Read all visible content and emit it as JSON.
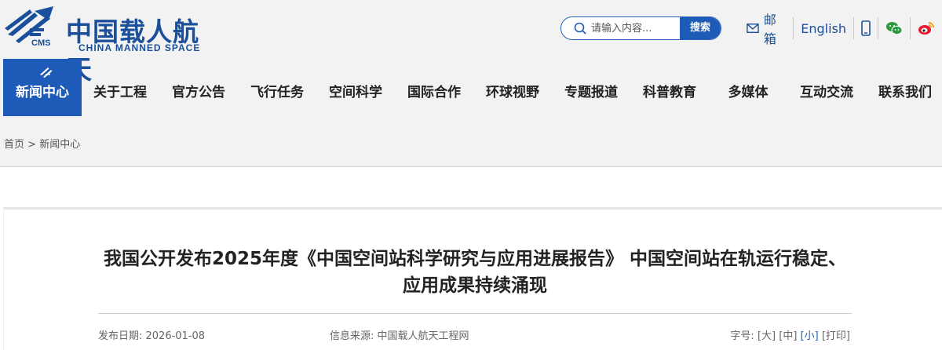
{
  "header": {
    "logo_cn": "中国载人航天",
    "logo_en": "CHINA MANNED SPACE",
    "logo_abbr": "CMS",
    "search_placeholder": "请输入内容...",
    "search_button": "搜索",
    "mail_label": "邮箱",
    "english_label": "English",
    "icons": [
      "mail-icon",
      "mobile-icon",
      "wechat-icon",
      "weibo-icon"
    ]
  },
  "nav": {
    "items": [
      "新闻中心",
      "关于工程",
      "官方公告",
      "飞行任务",
      "空间科学",
      "国际合作",
      "环球视野",
      "专题报道",
      "科普教育",
      "多媒体",
      "互动交流",
      "联系我们"
    ],
    "active": "新闻中心"
  },
  "breadcrumb": {
    "home": "首页",
    "separator": ">",
    "current": "新闻中心"
  },
  "article": {
    "title": "我国公开发布2025年度《中国空间站科学研究与应用进展报告》 中国空间站在轨运行稳定、应用成果持续涌现",
    "publish_date": "发布日期: 2026-01-08",
    "source": "信息来源: 中国载人航天工程网",
    "font_size_label": "字号:",
    "font_sizes": [
      "[大]",
      "[中]",
      "[小]"
    ],
    "selected_font_size": "[小]",
    "print_label": "[打印]"
  },
  "colors": {
    "brand_blue": "#1e5bb8",
    "logo_blue": "#1a4f9c",
    "background": "#f2f2f2"
  }
}
